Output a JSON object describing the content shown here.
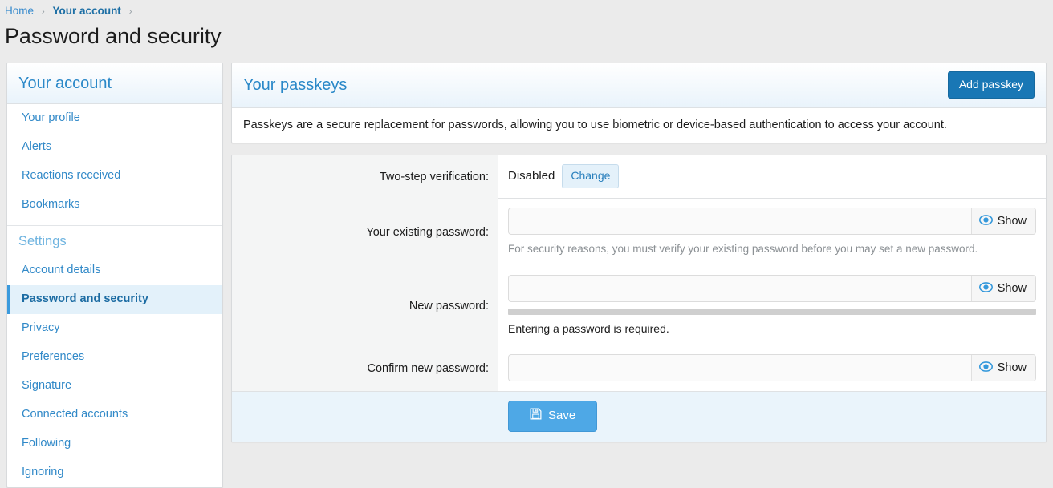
{
  "breadcrumb": {
    "items": [
      {
        "label": "Home",
        "current": false
      },
      {
        "label": "Your account",
        "current": true
      }
    ],
    "separator": "›"
  },
  "page": {
    "title": "Password and security"
  },
  "sidebar": {
    "header": "Your account",
    "items": [
      {
        "label": "Your profile",
        "active": false
      },
      {
        "label": "Alerts",
        "active": false
      },
      {
        "label": "Reactions received",
        "active": false
      },
      {
        "label": "Bookmarks",
        "active": false
      }
    ],
    "settings_heading": "Settings",
    "settings_items": [
      {
        "label": "Account details",
        "active": false
      },
      {
        "label": "Password and security",
        "active": true
      },
      {
        "label": "Privacy",
        "active": false
      },
      {
        "label": "Preferences",
        "active": false
      },
      {
        "label": "Signature",
        "active": false
      },
      {
        "label": "Connected accounts",
        "active": false
      },
      {
        "label": "Following",
        "active": false
      },
      {
        "label": "Ignoring",
        "active": false
      }
    ]
  },
  "passkeys": {
    "title": "Your passkeys",
    "add_button": "Add passkey",
    "description": "Passkeys are a secure replacement for passwords, allowing you to use biometric or device-based authentication to access your account."
  },
  "form": {
    "two_step": {
      "label": "Two-step verification:",
      "status": "Disabled",
      "change_button": "Change"
    },
    "existing_password": {
      "label": "Your existing password:",
      "value": "",
      "placeholder": "",
      "show_button": "Show",
      "hint": "For security reasons, you must verify your existing password before you may set a new password."
    },
    "new_password": {
      "label": "New password:",
      "value": "",
      "placeholder": "",
      "show_button": "Show",
      "strength_message": "Entering a password is required.",
      "strength_percent": 0
    },
    "confirm_password": {
      "label": "Confirm new password:",
      "value": "",
      "placeholder": "",
      "show_button": "Show"
    },
    "save_button": "Save"
  },
  "colors": {
    "page_background": "#ebebeb",
    "link_blue": "#3388cc",
    "accent_blue": "#2a88c8",
    "primary_button": "#1977b5",
    "save_button": "#4ea8e6",
    "active_item_background": "#e3f1fa",
    "label_column_background": "#f4f5f5",
    "footer_background": "#eaf4fb",
    "strength_bar": "#cfcfcf"
  }
}
